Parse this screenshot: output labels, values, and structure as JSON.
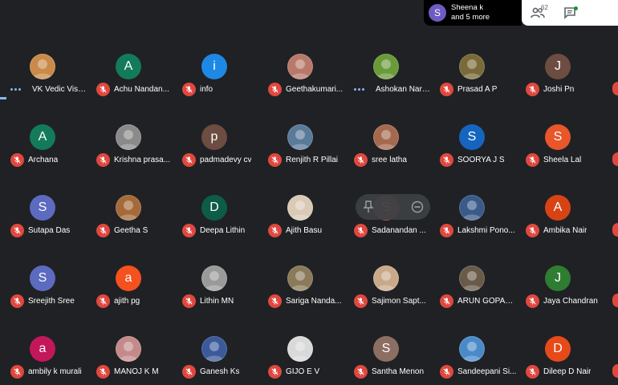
{
  "notification": {
    "avatar_letter": "S",
    "line1": "Sheena k",
    "line2": "and 5 more",
    "avatar_color": "#6f5bc3"
  },
  "controls": {
    "participants_count": "62"
  },
  "participants": [
    {
      "name": "VK Vedic Visio...",
      "avatar": "photo",
      "status": "speaking",
      "color": "#c98a4a"
    },
    {
      "name": "Achu Nandan...",
      "avatar": "A",
      "status": "muted",
      "color": "#137a5a"
    },
    {
      "name": "info",
      "avatar": "i",
      "status": "muted",
      "color": "#1e88e5"
    },
    {
      "name": "Geethakumari...",
      "avatar": "photo",
      "status": "muted",
      "color": "#b8786a"
    },
    {
      "name": "Ashokan Nara...",
      "avatar": "photo",
      "status": "speaking",
      "color": "#6a9a3a"
    },
    {
      "name": "Prasad A P",
      "avatar": "photo",
      "status": "muted",
      "color": "#7a6a3a"
    },
    {
      "name": "Joshi Pn",
      "avatar": "J",
      "status": "muted",
      "color": "#6d4c41"
    },
    {
      "name": "Archana",
      "avatar": "A",
      "status": "muted",
      "color": "#137a5a"
    },
    {
      "name": "Krishna prasa...",
      "avatar": "photo",
      "status": "muted",
      "color": "#8a8a8a"
    },
    {
      "name": "padmadevy cv",
      "avatar": "p",
      "status": "muted",
      "color": "#6d4c41"
    },
    {
      "name": "Renjith R Pillai",
      "avatar": "photo",
      "status": "muted",
      "color": "#5a7a9a"
    },
    {
      "name": "sree latha",
      "avatar": "photo",
      "status": "muted",
      "color": "#a5694f"
    },
    {
      "name": "SOORYA J S",
      "avatar": "S",
      "status": "muted",
      "color": "#1565c0"
    },
    {
      "name": "Sheela Lal",
      "avatar": "S",
      "status": "muted",
      "color": "#e8562a"
    },
    {
      "name": "Sutapa Das",
      "avatar": "S",
      "status": "muted",
      "color": "#5c6bc0"
    },
    {
      "name": "Geetha S",
      "avatar": "photo",
      "status": "muted",
      "color": "#a56a3a"
    },
    {
      "name": "Deepa Lithin",
      "avatar": "D",
      "status": "muted",
      "color": "#0d5c47"
    },
    {
      "name": "Ajith Basu",
      "avatar": "photo",
      "status": "muted",
      "color": "#d9c9b5"
    },
    {
      "name": "Sadanandan ...",
      "avatar": "S",
      "status": "muted",
      "color": "#c7533a"
    },
    {
      "name": "Lakshmi Pono...",
      "avatar": "photo",
      "status": "muted",
      "color": "#3a5a8a"
    },
    {
      "name": "Ambika Nair",
      "avatar": "A",
      "status": "muted",
      "color": "#d84315"
    },
    {
      "name": "Sreejith Sree",
      "avatar": "S",
      "status": "muted",
      "color": "#5c6bc0"
    },
    {
      "name": "ajith pg",
      "avatar": "a",
      "status": "muted",
      "color": "#f4511e"
    },
    {
      "name": "Lithin MN",
      "avatar": "photo",
      "status": "muted",
      "color": "#9a9a9a"
    },
    {
      "name": "Sariga Nanda...",
      "avatar": "photo",
      "status": "muted",
      "color": "#8a7a5a"
    },
    {
      "name": "Sajimon Sapt...",
      "avatar": "photo",
      "status": "muted",
      "color": "#c9a98a"
    },
    {
      "name": "ARUN GOPAL ...",
      "avatar": "photo",
      "status": "muted",
      "color": "#6a5a4a"
    },
    {
      "name": "Jaya Chandran",
      "avatar": "J",
      "status": "muted",
      "color": "#2e7d32"
    },
    {
      "name": "ambily k murali",
      "avatar": "a",
      "status": "muted",
      "color": "#c2185b"
    },
    {
      "name": "MANOJ K M",
      "avatar": "photo",
      "status": "muted",
      "color": "#c48a8a"
    },
    {
      "name": "Ganesh Ks",
      "avatar": "photo",
      "status": "muted",
      "color": "#3a5a9a"
    },
    {
      "name": "GIJO E V",
      "avatar": "photo",
      "status": "muted",
      "color": "#d9d9d9"
    },
    {
      "name": "Santha Menon",
      "avatar": "S",
      "status": "muted",
      "color": "#8d6e63"
    },
    {
      "name": "Sandeepani Si...",
      "avatar": "photo",
      "status": "muted",
      "color": "#4a8ac9"
    },
    {
      "name": "Dileep D Nair",
      "avatar": "D",
      "status": "muted",
      "color": "#e64a19"
    }
  ]
}
